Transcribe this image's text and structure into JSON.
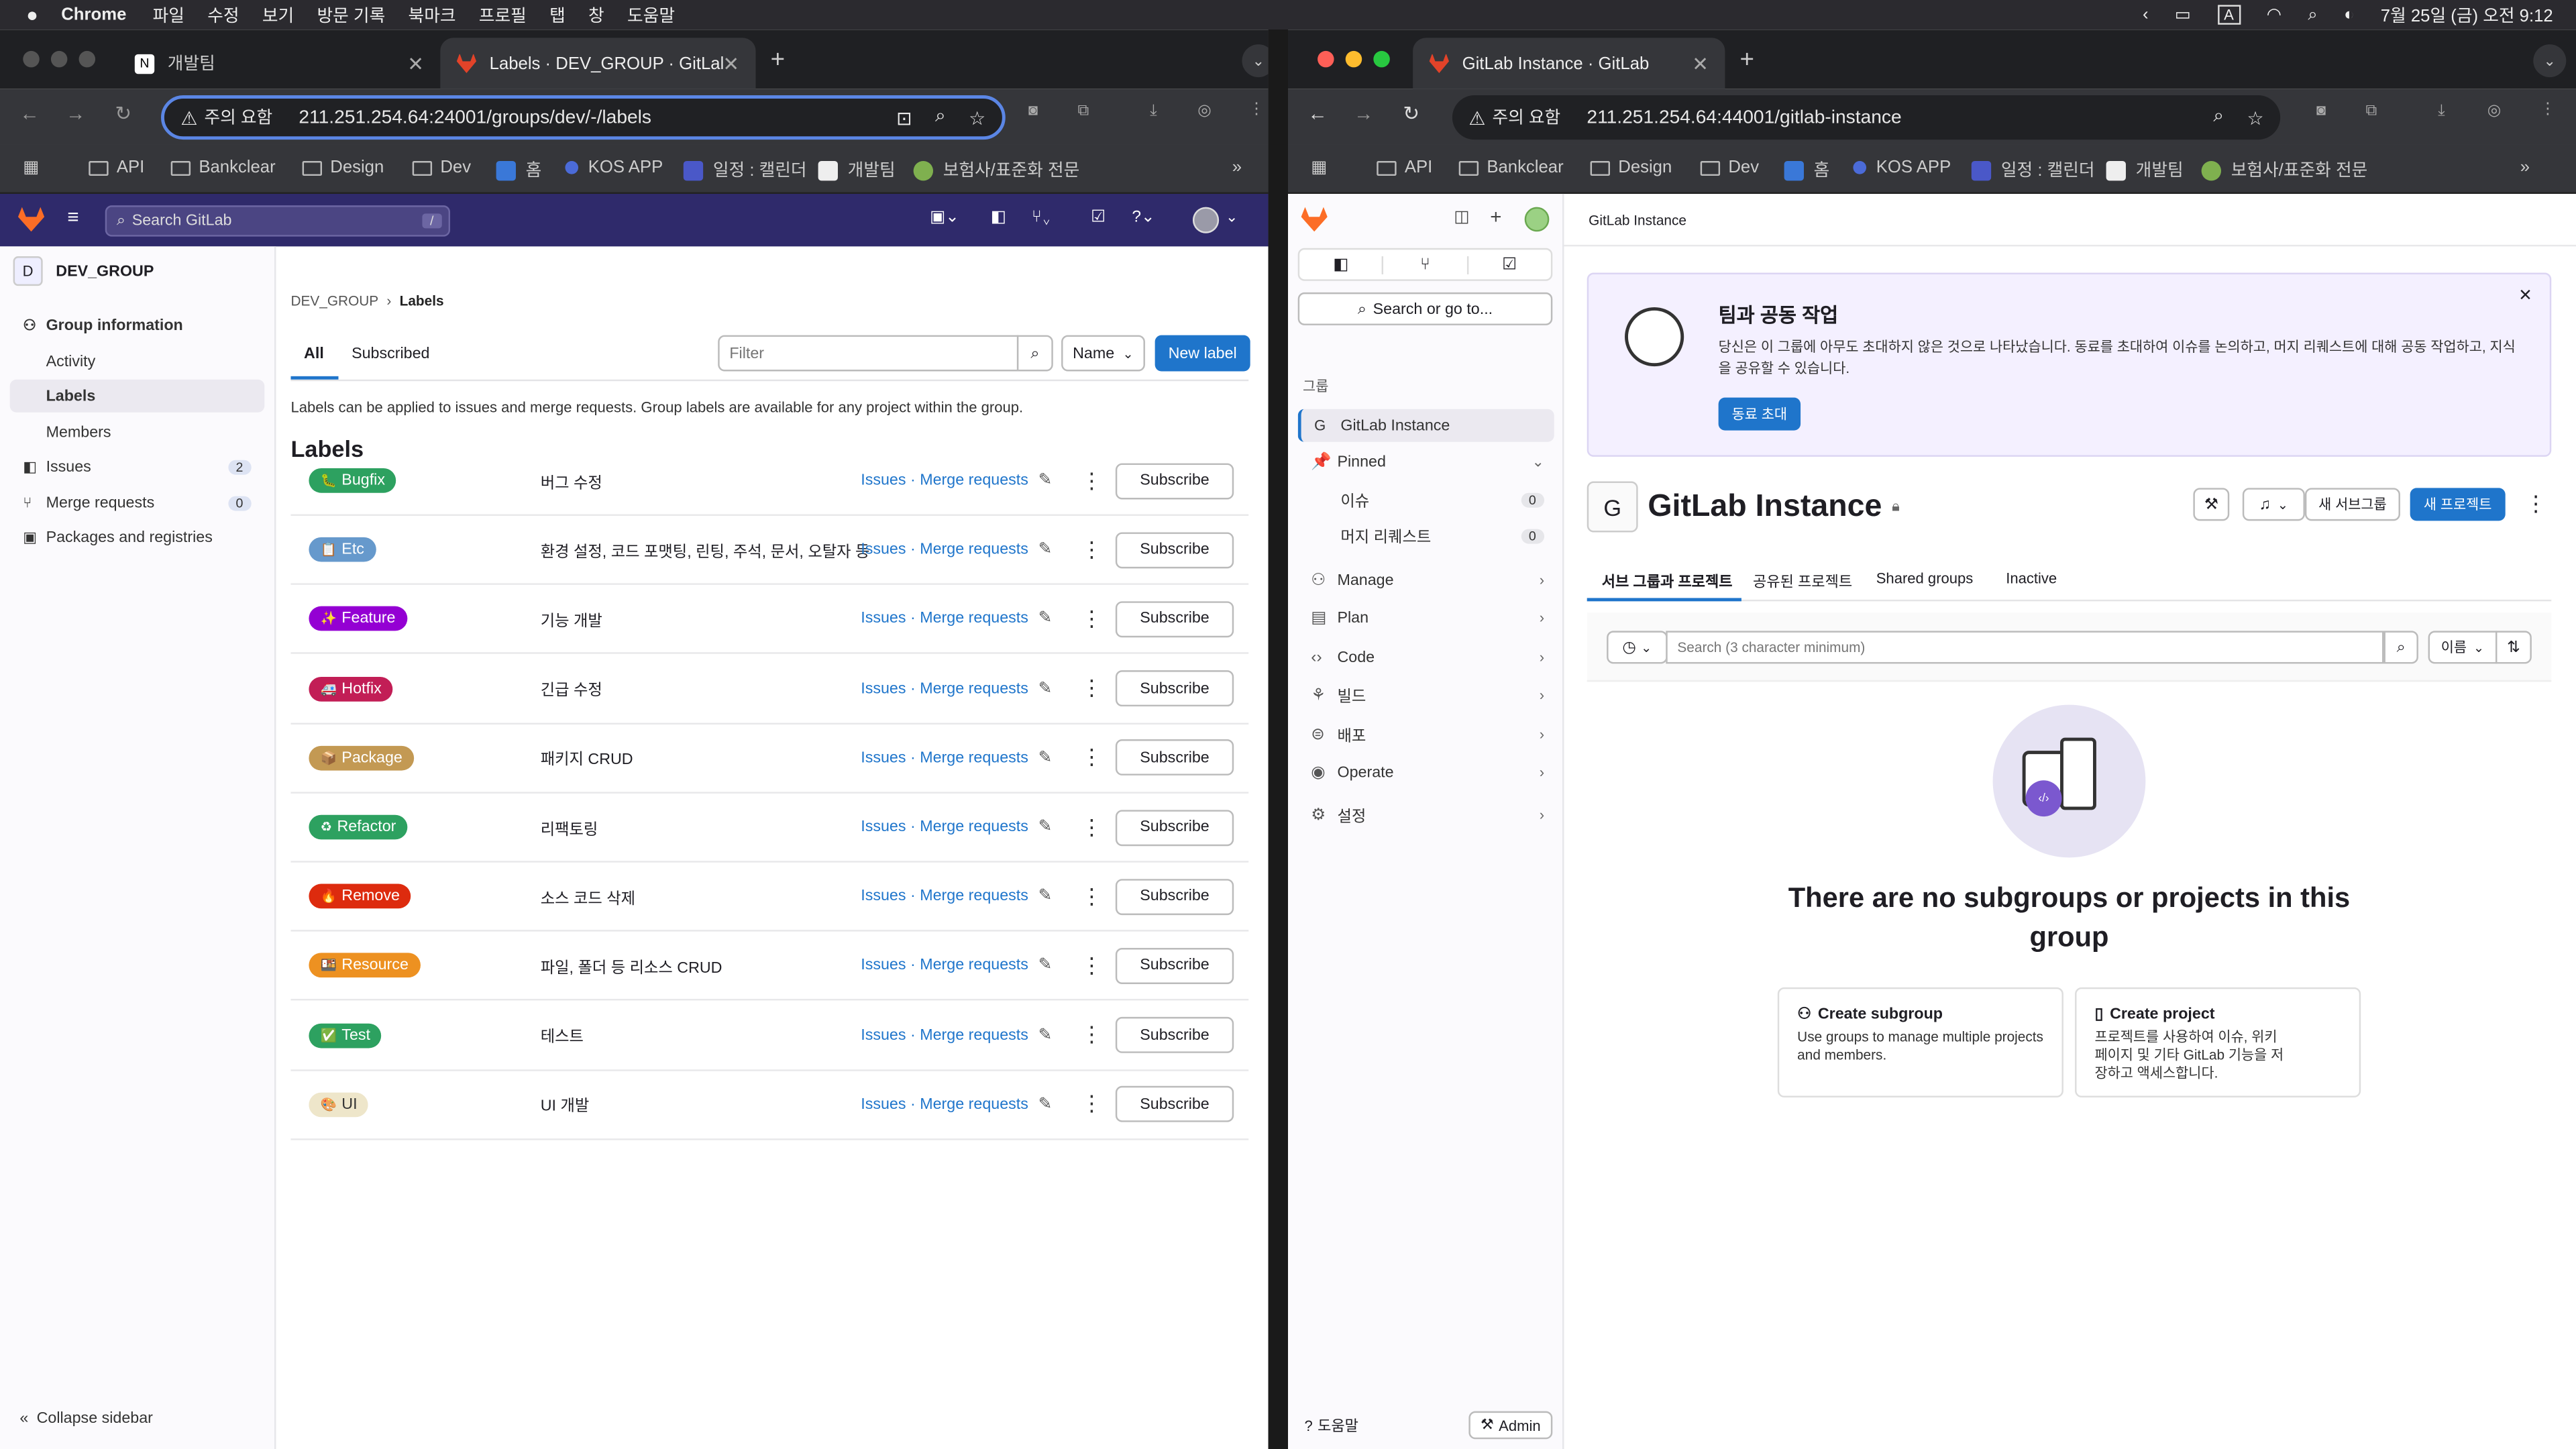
{
  "menubar": {
    "app": "Chrome",
    "items": [
      "파일",
      "수정",
      "보기",
      "방문 기록",
      "북마크",
      "프로필",
      "탭",
      "창",
      "도움말"
    ],
    "datetime": "7월 25일 (금) 오전 9:12"
  },
  "left": {
    "tabs": [
      {
        "title": "개발팀"
      },
      {
        "title": "Labels · DEV_GROUP · GitLab"
      }
    ],
    "security": "주의 요함",
    "url": "211.251.254.64:24001/groups/dev/-/labels",
    "bookmarks": [
      "API",
      "Bankclear",
      "Design",
      "Dev",
      "홈",
      "KOS APP",
      "일정 : 캘린더",
      "개발팀",
      "보험사/표준화 전문"
    ],
    "search_placeholder": "Search GitLab",
    "search_shortcut": "/",
    "group_initial": "D",
    "group_name": "DEV_GROUP",
    "nav": {
      "group_info": "Group information",
      "activity": "Activity",
      "labels": "Labels",
      "members": "Members",
      "issues": "Issues",
      "issues_count": "2",
      "mrs": "Merge requests",
      "mrs_count": "0",
      "packages": "Packages and registries"
    },
    "collapse": "Collapse sidebar",
    "breadcrumb": {
      "group": "DEV_GROUP",
      "current": "Labels"
    },
    "filter_tabs": {
      "all": "All",
      "subscribed": "Subscribed"
    },
    "filter_placeholder": "Filter",
    "sort": "Name",
    "new_label": "New label",
    "intro": "Labels can be applied to issues and merge requests. Group labels are available for any project within the group.",
    "heading": "Labels",
    "issues_link": "Issues",
    "mr_link": "Merge requests",
    "subscribe": "Subscribe",
    "labels": [
      {
        "name": "Bugfix",
        "emoji": "🐛",
        "color": "#2da160",
        "desc": "버그 수정"
      },
      {
        "name": "Etc",
        "emoji": "📋",
        "color": "#6699cc",
        "desc": "환경 설정, 코드 포맷팅, 린팅, 주석, 문서, 오탈자 등"
      },
      {
        "name": "Feature",
        "emoji": "✨",
        "color": "#9400d3",
        "desc": "기능 개발"
      },
      {
        "name": "Hotfix",
        "emoji": "🚑",
        "color": "#c21e56",
        "desc": "긴급 수정"
      },
      {
        "name": "Package",
        "emoji": "📦",
        "color": "#c39953",
        "desc": "패키지 CRUD"
      },
      {
        "name": "Refactor",
        "emoji": "♻",
        "color": "#2da160",
        "desc": "리팩토링"
      },
      {
        "name": "Remove",
        "emoji": "🔥",
        "color": "#dd2b0e",
        "desc": "소스 코드 삭제"
      },
      {
        "name": "Resource",
        "emoji": "🍱",
        "color": "#ed9121",
        "desc": "파일, 폴더 등 리소스 CRUD"
      },
      {
        "name": "Test",
        "emoji": "✅",
        "color": "#2da160",
        "desc": "테스트"
      },
      {
        "name": "UI",
        "emoji": "🎨",
        "color": "#eee6ca",
        "desc": "UI 개발"
      }
    ]
  },
  "right": {
    "tab": "GitLab Instance · GitLab",
    "security": "주의 요함",
    "url": "211.251.254.64:44001/gitlab-instance",
    "search_btn": "Search or go to...",
    "section": "그룹",
    "group_initial": "G",
    "group_item": "GitLab Instance",
    "pinned": "Pinned",
    "pinned_issues": "이슈",
    "pinned_issues_count": "0",
    "pinned_mrs": "머지 리퀘스트",
    "pinned_mrs_count": "0",
    "nav": [
      "Manage",
      "Plan",
      "Code",
      "빌드",
      "배포",
      "Operate",
      "설정"
    ],
    "help": "도움말",
    "admin": "Admin",
    "breadcrumb": "GitLab Instance",
    "banner_title": "팀과 공동 작업",
    "banner_text": "당신은 이 그룹에 아무도 초대하지 않은 것으로 나타났습니다. 동료를 초대하여 이슈를 논의하고, 머지 리퀘스트에 대해 공동 작업하고, 지식을 공유할 수 있습니다.",
    "invite": "동료 초대",
    "title": "GitLab Instance",
    "new_subgroup": "새 서브그룹",
    "new_project": "새 프로젝트",
    "tabs": [
      "서브 그룹과 프로젝트",
      "공유된 프로젝트",
      "Shared groups",
      "Inactive"
    ],
    "search_placeholder": "Search (3 character minimum)",
    "sort": "이름",
    "empty_title": "There are no subgroups or projects in this group",
    "create_subgroup": "Create subgroup",
    "create_subgroup_desc": "Use groups to manage multiple projects and members.",
    "create_project": "Create project",
    "create_project_desc": "프로젝트를 사용하여 이슈, 위키 페이지 및 기타 GitLab 기능을 저장하고 액세스합니다."
  }
}
